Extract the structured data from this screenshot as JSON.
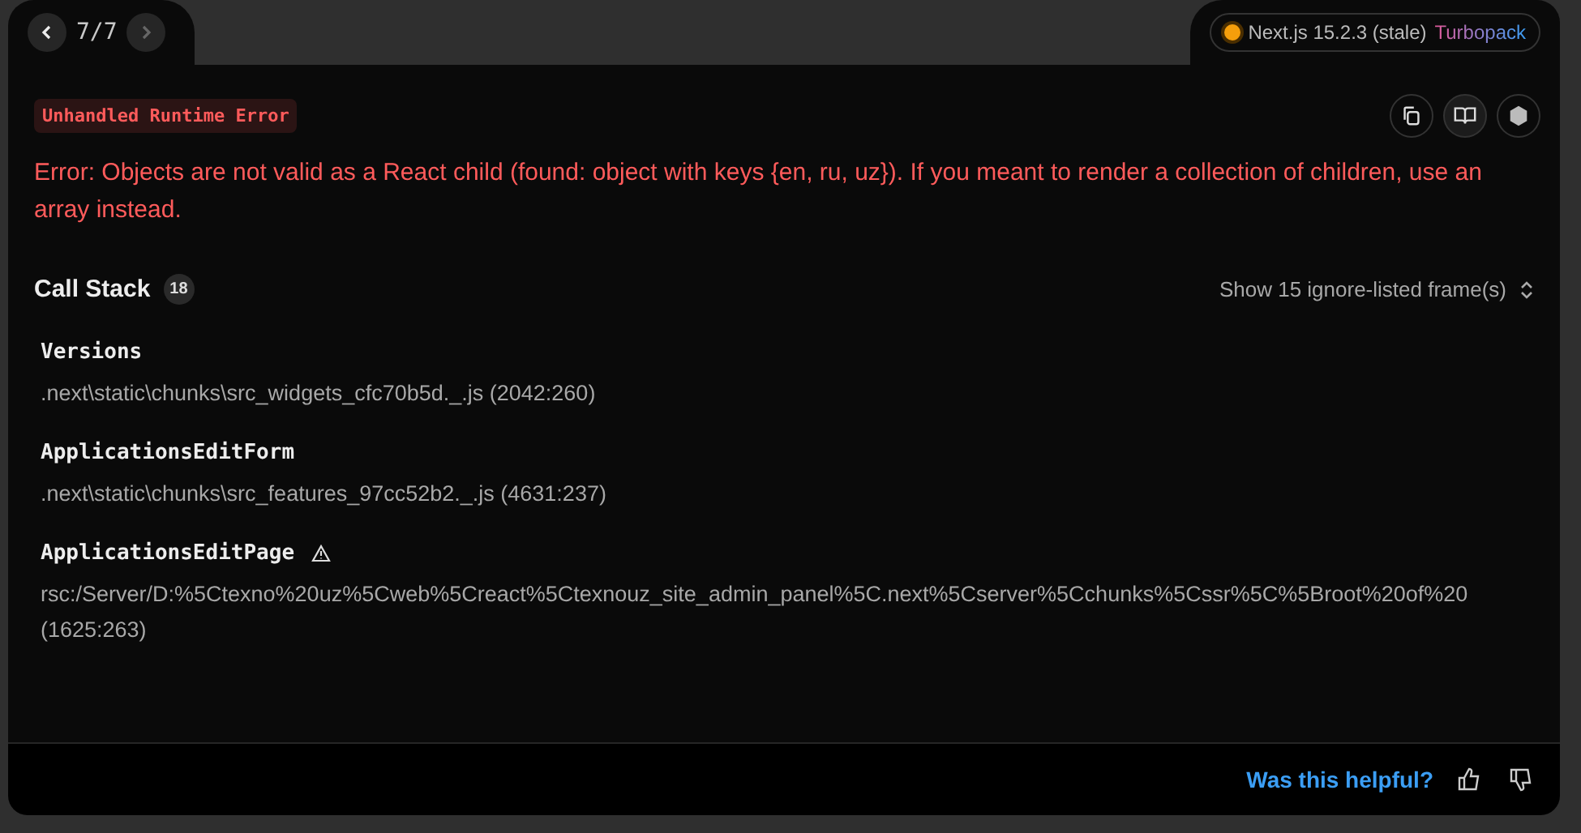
{
  "nav": {
    "counter": "7/7",
    "prev_disabled": false,
    "next_disabled": true
  },
  "version_badge": {
    "version": "Next.js 15.2.3 (stale)",
    "bundler": "Turbopack"
  },
  "error_type": "Unhandled Runtime Error",
  "message": "Error: Objects are not valid as a React child (found: object with keys {en, ru, uz}). If you meant to render a collection of children, use an array instead.",
  "call_stack": {
    "title": "Call Stack",
    "count": "18",
    "toggle": "Show 15 ignore-listed frame(s)",
    "frames": [
      {
        "name": "Versions",
        "warning": false,
        "location": ".next\\static\\chunks\\src_widgets_cfc70b5d._.js (2042:260)"
      },
      {
        "name": "ApplicationsEditForm",
        "warning": false,
        "location": ".next\\static\\chunks\\src_features_97cc52b2._.js (4631:237)"
      },
      {
        "name": "ApplicationsEditPage",
        "warning": true,
        "location": "rsc:/Server/D:%5Ctexno%20uz%5Cweb%5Creact%5Ctexnouz_site_admin_panel%5C.next%5Cserver%5Cchunks%5Cssr%5C%5Broot%20of%20",
        "position": "(1625:263)"
      }
    ]
  },
  "footer": {
    "question": "Was this helpful?"
  }
}
